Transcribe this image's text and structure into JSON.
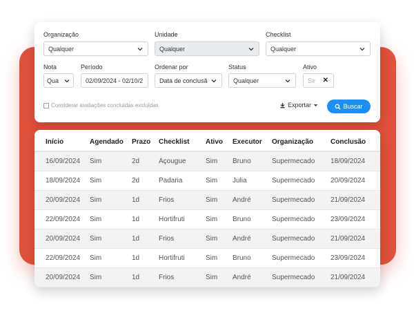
{
  "filters": {
    "organizacao": {
      "label": "Organização",
      "value": "Qualquer"
    },
    "unidade": {
      "label": "Unidade",
      "value": "Qualquer"
    },
    "checklist": {
      "label": "Checklist",
      "value": "Qualquer"
    },
    "nota": {
      "label": "Nota",
      "value": "Qua"
    },
    "periodo": {
      "label": "Período",
      "value": "02/09/2024 - 02/10/2"
    },
    "ordenar_por": {
      "label": "Ordenar por",
      "value": "Data de conclusã"
    },
    "status": {
      "label": "Status",
      "value": "Qualquer"
    },
    "ativo": {
      "label": "Ativo",
      "value": "Sir"
    },
    "checkbox_label": "Considerar avaliações concluídas excluídas",
    "export_label": "Exportar",
    "search_label": "Buscar"
  },
  "table": {
    "headers": [
      "Início",
      "Agendado",
      "Prazo",
      "Checklist",
      "Ativo",
      "Executor",
      "Organização",
      "Conclusão"
    ],
    "rows": [
      [
        "16/09/2024",
        "Sim",
        "2d",
        "Açougue",
        "Sim",
        "Bruno",
        "Supermecado",
        "18/09/2024"
      ],
      [
        "18/09/2024",
        "Sim",
        "2d",
        "Padaria",
        "Sim",
        "Julia",
        "Supermecado",
        "20/09/2024"
      ],
      [
        "20/09/2024",
        "Sim",
        "1d",
        "Frios",
        "Sim",
        "André",
        "Supermecado",
        "21/09/2024"
      ],
      [
        "22/09/2024",
        "Sim",
        "1d",
        "Hortifruti",
        "Sim",
        "Bruno",
        "Supermecado",
        "23/09/2024"
      ],
      [
        "20/09/2024",
        "Sim",
        "1d",
        "Frios",
        "Sim",
        "André",
        "Supermecado",
        "21/09/2024"
      ],
      [
        "22/09/2024",
        "Sim",
        "1d",
        "Hortifruti",
        "Sim",
        "Bruno",
        "Supermecado",
        "23/09/2024"
      ],
      [
        "20/09/2024",
        "Sim",
        "1d",
        "Frios",
        "Sim",
        "André",
        "Supermecado",
        "21/09/2024"
      ]
    ]
  },
  "colors": {
    "accent": "#1e8ff0",
    "background_shape": "#e1523d"
  }
}
